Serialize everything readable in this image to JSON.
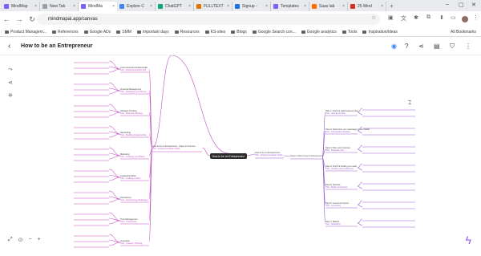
{
  "browser": {
    "tabs": [
      {
        "label": "MindMap",
        "color": "#7b61ff",
        "active": false
      },
      {
        "label": "New Tab",
        "color": "#9aa0a6",
        "active": false
      },
      {
        "label": "MindMa",
        "color": "#7b61ff",
        "active": true
      },
      {
        "label": "Explore C",
        "color": "#4285f4",
        "active": false
      },
      {
        "label": "ChatGPT",
        "color": "#10a37f",
        "active": false
      },
      {
        "label": "FULLTEXT",
        "color": "#e37400",
        "active": false
      },
      {
        "label": "Signup - ",
        "color": "#1a73e8",
        "active": false
      },
      {
        "label": "Templates",
        "color": "#7b61ff",
        "active": false
      },
      {
        "label": "Saas lab",
        "color": "#ff6d00",
        "active": false
      },
      {
        "label": "25 Mind",
        "color": "#d93025",
        "active": false
      }
    ],
    "new_tab": "+",
    "url": "mindmapai.app/canvas",
    "bookmarks": [
      "Product Managem...",
      "References",
      "Google ADs",
      "SMM",
      "important days",
      "Resources",
      "KS-sites",
      "Blogs",
      "Google Search con...",
      "Google analytics",
      "Tools",
      "Inspiration/ideas"
    ],
    "all_bookmarks": "All Bookmarks"
  },
  "app": {
    "back_icon": "arrow-left-icon",
    "title": "How to be an Entrepreneur"
  },
  "mindmap": {
    "root": "How to be an Entrepreneur",
    "left_hubs": [
      {
        "label": "Learn business fundamentals",
        "sub": "Title - Entrepreneurship 101"
      },
      {
        "label": "Financial Management",
        "sub": "Title - Managing your Money"
      },
      {
        "label": "Strategic Thinking",
        "sub": "Title - Business Strategy"
      },
      {
        "label": "Networking",
        "sub": "Title - Building Relationships"
      },
      {
        "label": "Marketing",
        "sub": "Title - Growing your Brand"
      },
      {
        "label": "Leadership Skills",
        "sub": "Title - Leading a Team"
      },
      {
        "label": "Persistence",
        "sub": "Title - Overcoming Challenges"
      },
      {
        "label": "Time Management",
        "sub": "Title - Productivity"
      },
      {
        "label": "Innovation",
        "sub": "Title - Creative Thinking"
      }
    ],
    "left_hub_main": {
      "label": "How to be an Entrepreneur - Steps to Success",
      "sub": "Title - Entrepreneurship Guide"
    },
    "right_hub1": {
      "label": "How to be an Entrepreneur",
      "sub": "Title - Entrepreneurship Guide"
    },
    "right_hub2": "Steps to Becoming an Entrepreneur",
    "right_steps": [
      {
        "label": "Step 1: Find the right business idea",
        "sub": "Title - Identify an idea"
      },
      {
        "label": "Step 2: Determine your advantage in the market",
        "sub": "Title - Competitive Analysis"
      },
      {
        "label": "Step 3: Plan your business",
        "sub": "Title - Business plan"
      },
      {
        "label": "Step 4: Find the funding you need",
        "sub": "Title - Funding and Investment"
      },
      {
        "label": "Step 5: Network",
        "sub": "Title - Build connections"
      },
      {
        "label": "Step 6: Launch and grow",
        "sub": "Title - Launching"
      },
      {
        "label": "Step 7: Market",
        "sub": "Title - Marketing"
      }
    ]
  },
  "colors": {
    "accent": "#7b61ff",
    "left_branch": "#c44fc4",
    "right_branch": "#9b59d0",
    "root_bg": "#2b2b2b"
  }
}
